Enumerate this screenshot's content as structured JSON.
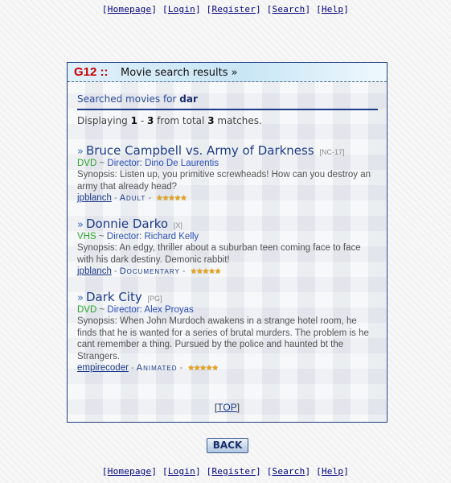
{
  "nav": {
    "items": [
      "Homepage",
      "Login",
      "Register",
      "Search",
      "Help"
    ]
  },
  "panel": {
    "code": "G12 ::",
    "title": "Movie search results »"
  },
  "search": {
    "label": "Searched movies for",
    "term": "dar"
  },
  "results": {
    "prefix": "Displaying",
    "from": "1",
    "sep": "-",
    "to": "3",
    "mid": "from total",
    "total": "3",
    "suffix": "matches."
  },
  "movies": [
    {
      "title": "Bruce Campbell vs. Army of Darkness",
      "rating": "[NC-17]",
      "format": "DVD",
      "director_label": "Director:",
      "director": "Dino De Laurentis",
      "synopsis": "Synopsis: Listen up, you primitive screwheads! How can you destroy an army that already head?",
      "user": "jpblanch",
      "genre": "Adult",
      "stars": 5
    },
    {
      "title": "Donnie Darko",
      "rating": "[X]",
      "format": "VHS",
      "director_label": "Director:",
      "director": "Richard Kelly",
      "synopsis": "Synopsis: An edgy, thriller about a suburban teen coming face to face with his dark destiny. Demonic rabbit!",
      "user": "jpblanch",
      "genre": "Documentary",
      "stars": 5
    },
    {
      "title": "Dark City",
      "rating": "[PG]",
      "format": "DVD",
      "director_label": "Director:",
      "director": "Alex Proyas",
      "synopsis": "Synopsis: When John Murdoch awakens in a strange hotel room, he finds that he is wanted for a series of brutal murders. The problem is he cant remember a thing. Pursued by the police and haunted bt the Strangers.",
      "user": "empirecoder",
      "genre": "Animated",
      "stars": 5
    }
  ],
  "top_link": "TOP",
  "back_label": "BACK",
  "colors": {
    "accent": "#1d3a8a",
    "code_red": "#cc0000",
    "format_green": "#2aa62a",
    "star": "#e8a317"
  }
}
